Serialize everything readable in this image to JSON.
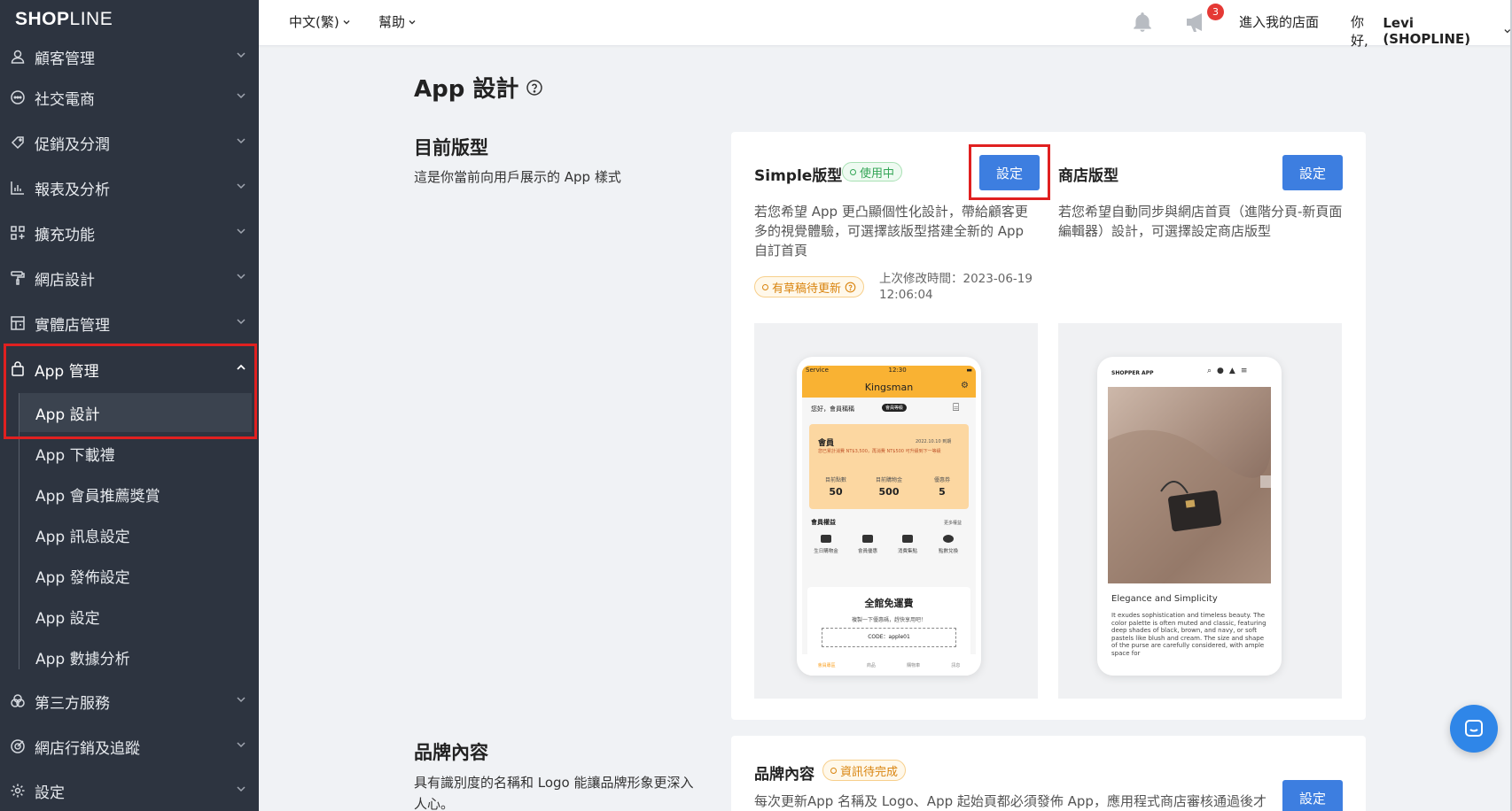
{
  "brand": {
    "logo_bold": "SHOP",
    "logo_thin": "LINE"
  },
  "sidebar": {
    "items": [
      {
        "label": "顧客管理",
        "icon": "user-icon"
      },
      {
        "label": "社交電商",
        "icon": "chat-bubble-icon"
      },
      {
        "label": "促銷及分潤",
        "icon": "tag-icon"
      },
      {
        "label": "報表及分析",
        "icon": "bar-chart-icon"
      },
      {
        "label": "擴充功能",
        "icon": "apps-grid-icon"
      },
      {
        "label": "網店設計",
        "icon": "paint-roller-icon"
      },
      {
        "label": "實體店管理",
        "icon": "store-icon"
      },
      {
        "label": "App 管理",
        "icon": "shopping-bag-icon",
        "expanded": true
      },
      {
        "label": "第三方服務",
        "icon": "circles-icon"
      },
      {
        "label": "網店行銷及追蹤",
        "icon": "target-icon"
      },
      {
        "label": "設定",
        "icon": "gear-icon"
      }
    ],
    "sub_items": [
      {
        "label": "App 設計",
        "active": true
      },
      {
        "label": "App 下載禮"
      },
      {
        "label": "App 會員推薦獎賞"
      },
      {
        "label": "App 訊息設定"
      },
      {
        "label": "App 發佈設定"
      },
      {
        "label": "App 設定"
      },
      {
        "label": "App 數據分析"
      }
    ]
  },
  "topbar": {
    "language": "中文(繁)",
    "help": "幫助",
    "notification_count": "3",
    "enter_store": "進入我的店面",
    "greeting": "你好, ",
    "user": "Levi (SHOPLINE)"
  },
  "page": {
    "title": "App 設計",
    "current_template": {
      "heading": "目前版型",
      "description": "這是你當前向用戶展示的 App 樣式"
    },
    "brand_content": {
      "heading": "品牌內容",
      "description": "具有識別度的名稱和 Logo 能讓品牌形象更深入人心。"
    }
  },
  "simple_template": {
    "title": "Simple版型",
    "status": "使用中",
    "button": "設定",
    "description": "若您希望 App 更凸顯個性化設計，帶給顧客更多的視覺體驗，可選擇該版型搭建全新的 App 自訂首頁",
    "draft_tag": "有草稿待更新",
    "modified_label": "上次修改時間：2023-06-19",
    "modified_time": "12:06:04"
  },
  "store_template": {
    "title": "商店版型",
    "button": "設定",
    "description": "若您希望自動同步與網店首頁（進階分頁-新頁面編輯器）設計，可選擇設定商店版型"
  },
  "brand_card": {
    "title": "品牌內容",
    "status": "資訊待完成",
    "button": "設定",
    "description": "每次更新App 名稱及 Logo、App 起始頁都必須發佈 App，應用程式商店審核通過後才"
  },
  "phone_preview": {
    "status_left": "Service",
    "time": "12:30",
    "brand": "Kingsman",
    "greeting": "您好，會員稱稱",
    "level_tag": "會員等級",
    "member": "會員",
    "date": "2022.10.10 到期",
    "member_note": "您已累計消費 NT$3,500，再消費 NT$500 可升級到下一等級",
    "stats": [
      {
        "label": "目前點數",
        "value": "50"
      },
      {
        "label": "目前購物金",
        "value": "500"
      },
      {
        "label": "優惠券",
        "value": "5"
      }
    ],
    "benefits_title": "會員權益",
    "benefits_more": "更多權益",
    "perks": [
      "生日購物金",
      "會員優惠",
      "消費集點",
      "點數兌換"
    ],
    "coupon_title": "全館免運費",
    "coupon_sub": "複製一下優惠碼，趕快享用吧！",
    "coupon_code": "CODE：apple01",
    "tabs": [
      "會員專區",
      "商品",
      "購物車",
      "訊息"
    ]
  },
  "shop_preview": {
    "app_name": "SHOPPER APP",
    "heading": "Elegance and Simplicity",
    "body": "It exudes sophistication and timeless beauty. The color palette is often muted and classic, featuring deep shades of black, brown, and navy, or soft pastels like blush and cream. The size and shape of the purse are carefully considered, with ample space for"
  },
  "colors": {
    "sidebar_bg": "#2d3440",
    "primary_button": "#3d7ee0",
    "highlight_red": "#e02020",
    "status_green": "#33a556",
    "status_orange": "#d9840f",
    "phone_accent": "#f9b233"
  }
}
